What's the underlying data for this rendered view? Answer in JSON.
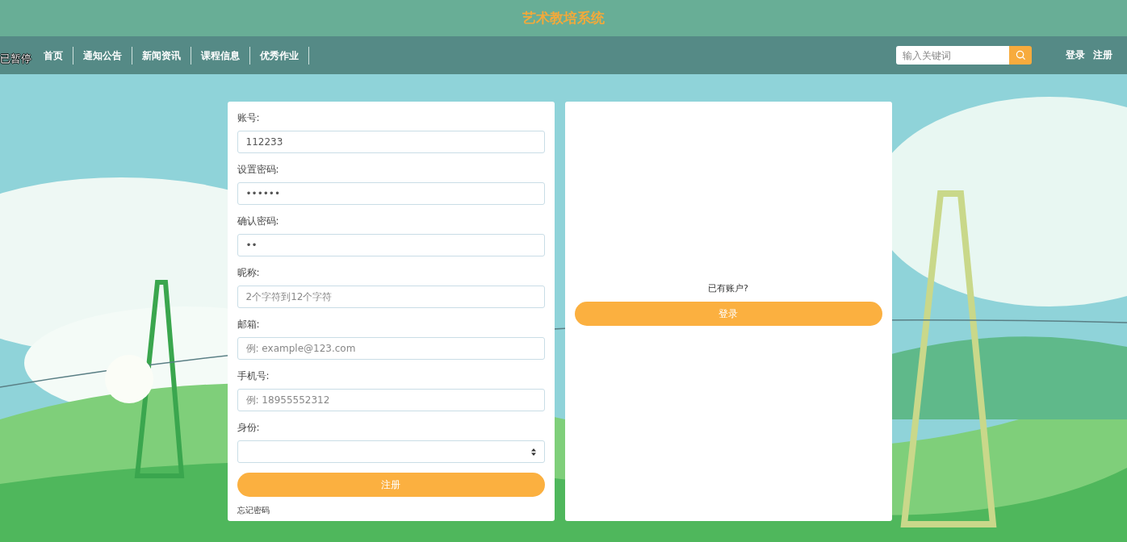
{
  "header": {
    "title": "艺术教培系统"
  },
  "overlay": {
    "status": "已暂停"
  },
  "nav": {
    "items": [
      {
        "label": "首页"
      },
      {
        "label": "通知公告"
      },
      {
        "label": "新闻资讯"
      },
      {
        "label": "课程信息"
      },
      {
        "label": "优秀作业"
      }
    ],
    "search": {
      "placeholder": "输入关键词"
    },
    "links": [
      "登录",
      "注册"
    ]
  },
  "register_form": {
    "fields": [
      {
        "kind": "text",
        "label": "账号:",
        "value": "112233"
      },
      {
        "kind": "text",
        "label": "设置密码:",
        "value": "••••••"
      },
      {
        "kind": "text",
        "label": "确认密码:",
        "value": "••"
      },
      {
        "kind": "text",
        "label": "昵称:",
        "placeholder": "2个字符到12个字符"
      },
      {
        "kind": "text",
        "label": "邮箱:",
        "placeholder": "例: example@123.com"
      },
      {
        "kind": "text",
        "label": "手机号:",
        "placeholder": "例: 18955552312"
      },
      {
        "kind": "select",
        "label": "身份:"
      }
    ],
    "submit": "注册",
    "forgot_link": "忘记密码"
  },
  "login_panel": {
    "prompt": "已有账户?",
    "button": "登录"
  }
}
